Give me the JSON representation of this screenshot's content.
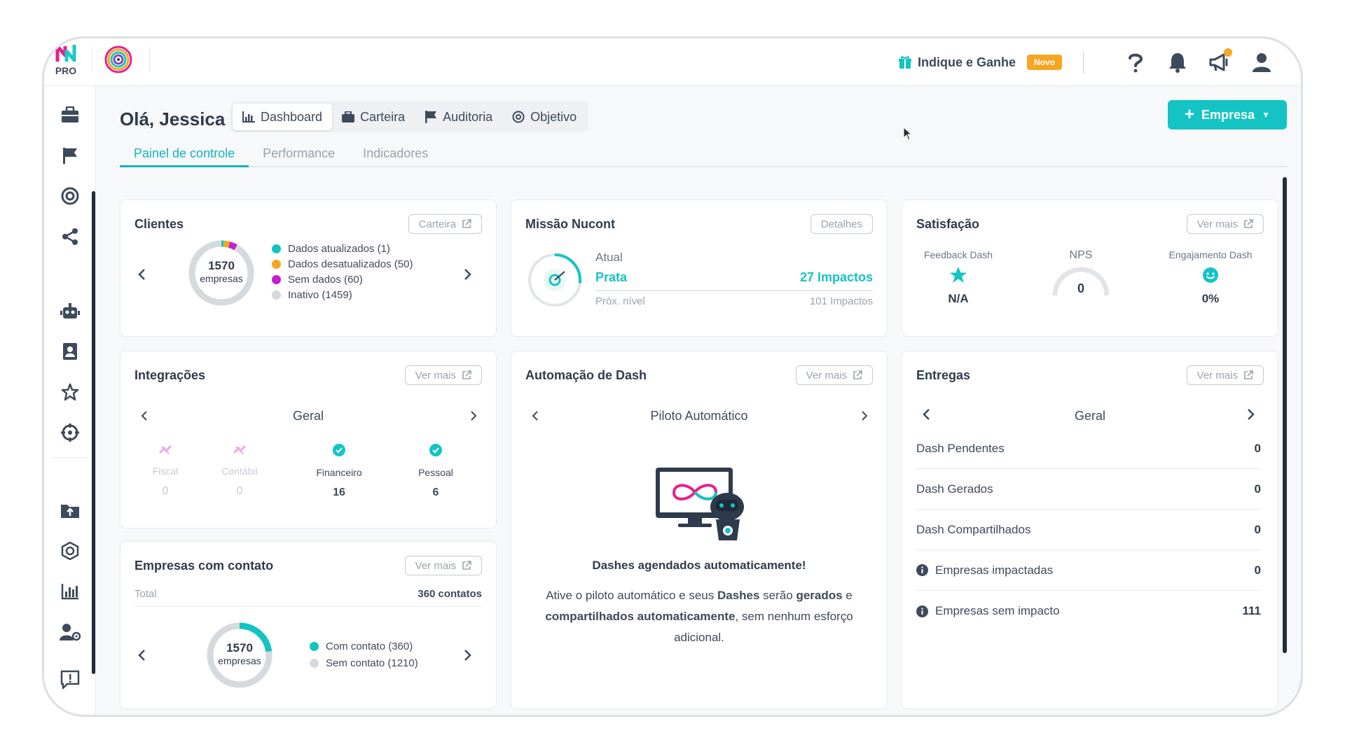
{
  "brand": {
    "pro_label": "PRO",
    "logo_accent": "#1fc8c8",
    "logo_pink": "#e91e8c"
  },
  "topbar": {
    "refer_label": "Indique e Ganhe",
    "new_badge": "Novo"
  },
  "header": {
    "greeting": "Olá, Jessica",
    "tabs": [
      {
        "label": "Dashboard",
        "icon": "bar-chart-icon"
      },
      {
        "label": "Carteira",
        "icon": "briefcase-icon"
      },
      {
        "label": "Auditoria",
        "icon": "flag-icon"
      },
      {
        "label": "Objetivo",
        "icon": "target-icon"
      }
    ],
    "new_company_label": "Empresa"
  },
  "subtabs": [
    "Painel de controle",
    "Performance",
    "Indicadores"
  ],
  "clientes": {
    "title": "Clientes",
    "button": "Carteira",
    "total": "1570",
    "total_unit": "empresas",
    "legend": [
      {
        "label": "Dados atualizados (1)",
        "value": 1,
        "color": "#14c4c4"
      },
      {
        "label": "Dados desatualizados (50)",
        "value": 50,
        "color": "#f5a623"
      },
      {
        "label": "Sem dados (60)",
        "value": 60,
        "color": "#c21fd0"
      },
      {
        "label": "Inativo (1459)",
        "value": 1459,
        "color": "#d5dadf"
      }
    ]
  },
  "missao": {
    "title": "Missão Nucont",
    "button": "Detalhes",
    "current_label": "Atual",
    "level": "Prata",
    "impacts": "27 Impactos",
    "next_label": "Próx. nível",
    "next_impacts": "101 Impactos",
    "progress": 0.27
  },
  "satisfacao": {
    "title": "Satisfação",
    "button": "Ver mais",
    "feedback_label": "Feedback Dash",
    "feedback_value": "N/A",
    "nps_label": "NPS",
    "nps_value": "0",
    "engajamento_label": "Engajamento Dash",
    "engajamento_value": "0%"
  },
  "integracoes": {
    "title": "Integrações",
    "button": "Ver mais",
    "group": "Geral",
    "items": [
      {
        "label": "Fiscal",
        "value": "0",
        "status": "inactive"
      },
      {
        "label": "Contábil",
        "value": "0",
        "status": "inactive"
      },
      {
        "label": "Financeiro",
        "value": "16",
        "status": "active"
      },
      {
        "label": "Pessoal",
        "value": "6",
        "status": "active"
      }
    ]
  },
  "automacao": {
    "title": "Automação de Dash",
    "button": "Ver mais",
    "group": "Piloto Automático",
    "heading": "Dashes agendados automaticamente!",
    "text_1": "Ative o piloto automático e seus ",
    "text_b1": "Dashes",
    "text_2": " serão ",
    "text_b2": "gerados",
    "text_3": " e ",
    "text_b3": "compartilhados automaticamente",
    "text_4": ", sem nenhum esforço adicional."
  },
  "entregas": {
    "title": "Entregas",
    "button": "Ver mais",
    "group": "Geral",
    "rows": [
      {
        "label": "Dash Pendentes",
        "value": "0",
        "info": false
      },
      {
        "label": "Dash Gerados",
        "value": "0",
        "info": false
      },
      {
        "label": "Dash Compartilhados",
        "value": "0",
        "info": false
      },
      {
        "label": "Empresas impactadas",
        "value": "0",
        "info": true
      },
      {
        "label": "Empresas sem impacto",
        "value": "111",
        "info": true
      }
    ]
  },
  "contato": {
    "title": "Empresas com contato",
    "button": "Ver mais",
    "total_label": "Total",
    "total_value": "360 contatos",
    "donut_total": "1570",
    "donut_unit": "empresas",
    "legend": [
      {
        "label": "Com contato (360)",
        "value": 360,
        "color": "#14c4c4"
      },
      {
        "label": "Sem contato (1210)",
        "value": 1210,
        "color": "#d5dadf"
      }
    ]
  },
  "colors": {
    "accent": "#14c4c4",
    "dark": "#2f3b4c",
    "muted": "#9aa3ae"
  }
}
